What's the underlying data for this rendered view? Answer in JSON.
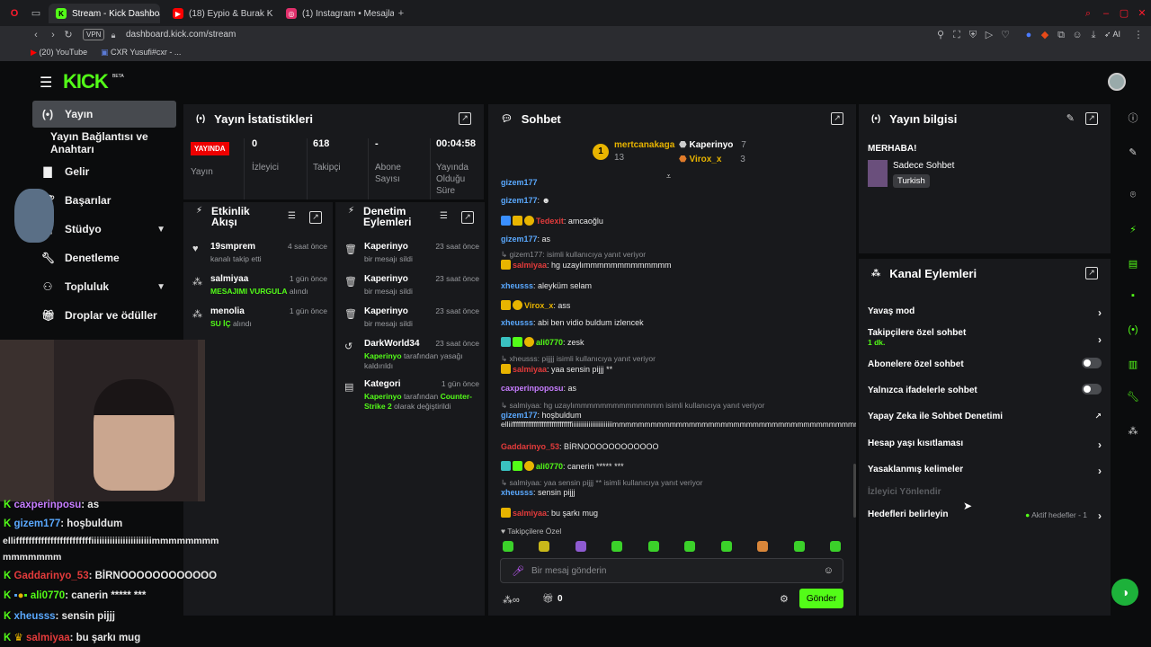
{
  "browser": {
    "tabs": [
      {
        "label": "Stream - Kick Dashboard",
        "active": true,
        "color": "#53fc18"
      },
      {
        "label": "(18) Eypio & Burak King",
        "active": false,
        "color": "#ff0000"
      },
      {
        "label": "(1) Instagram • Mesajlar",
        "active": false,
        "color": "#e1306c"
      }
    ],
    "vpn": "VPN",
    "url": "dashboard.kick.com/stream",
    "ai_label": "AI",
    "bookmarks": [
      "(20) YouTube",
      "CXR Yusufi#cxr - ..."
    ]
  },
  "kick": {
    "logo": "KICK",
    "beta": "BETA"
  },
  "sidebar": {
    "items": [
      {
        "label": "Yayın",
        "icon": "broadcast-icon",
        "active": true
      },
      {
        "label": "Yayın Bağlantısı ve Anahtarı",
        "icon": "",
        "active": false
      },
      {
        "label": "Gelir",
        "icon": "chart-icon",
        "active": false
      },
      {
        "label": "Başarılar",
        "icon": "trophy-icon",
        "active": false
      },
      {
        "label": "Stüdyo",
        "icon": "studio-icon",
        "active": false
      },
      {
        "label": "Denetleme",
        "icon": "wrench-icon",
        "active": false
      },
      {
        "label": "Topluluk",
        "icon": "community-icon",
        "active": false
      },
      {
        "label": "Droplar ve ödüller",
        "icon": "gift-icon",
        "active": false
      }
    ]
  },
  "stats": {
    "title": "Yayın İstatistikleri",
    "live": "YAYINDA",
    "live_label": "Yayın",
    "items": [
      {
        "value": "0",
        "label": "İzleyici"
      },
      {
        "value": "618",
        "label": "Takipçi"
      },
      {
        "value": "-",
        "label": "Abone Sayısı"
      },
      {
        "value": "00:04:58",
        "label": "Yayında Olduğu Süre"
      }
    ]
  },
  "activity": {
    "title": "Etkinlik Akışı",
    "items": [
      {
        "user": "19smprem",
        "time": "4 saat önce",
        "desc": "kanalı takip etti",
        "hl": ""
      },
      {
        "user": "salmiyaa",
        "time": "1 gün önce",
        "desc": "alındı",
        "hl": "MESAJIMI VURGULA"
      },
      {
        "user": "menolia",
        "time": "1 gün önce",
        "desc": "alındı",
        "hl": "SU İÇ"
      }
    ]
  },
  "moderation": {
    "title": "Denetim Eylemleri",
    "items": [
      {
        "user": "Kaperinyo",
        "time": "23 saat önce",
        "desc": "bir mesajı sildi"
      },
      {
        "user": "Kaperinyo",
        "time": "23 saat önce",
        "desc": "bir mesajı sildi"
      },
      {
        "user": "Kaperinyo",
        "time": "23 saat önce",
        "desc": "bir mesajı sildi"
      },
      {
        "user": "DarkWorld34",
        "time": "23 saat önce",
        "desc1": "Kaperinyo",
        "desc2": " tarafından yasağı kaldırıldı"
      },
      {
        "user": "Kategori",
        "time": "1 gün önce",
        "desc1": "Kaperinyo",
        "desc2": " tarafından ",
        "desc3": "Counter-Strike 2",
        "desc4": " olarak değiştirildi"
      }
    ]
  },
  "chat": {
    "title": "Sohbet",
    "top": [
      {
        "name": "mertcanakaga",
        "count": "13"
      },
      {
        "name": "Kaperinyo",
        "count": "7"
      },
      {
        "name": "Virox_x",
        "count": "3"
      }
    ],
    "messages": [
      {
        "user": "gizem177",
        "text": "",
        "color": "#5aa9ff"
      },
      {
        "user": "Tedexit",
        "text": ": amcaoğlu",
        "color": "#e33b3b"
      },
      {
        "user": "gizem177",
        "text": ": as",
        "color": "#5aa9ff"
      },
      {
        "reply": "gizem177:  isimli kullanıcıya yanıt veriyor",
        "user": "salmiyaa",
        "text": ": hg uzaylımmmmmmmmmmmmm",
        "color": "#e33b3b"
      },
      {
        "user": "xheusss",
        "text": ": aleyküm selam",
        "color": "#5aa9ff"
      },
      {
        "user": "Virox_x",
        "text": ": ass",
        "color": "#e8b400"
      },
      {
        "user": "xheusss",
        "text": ": abi ben vidio buldum izlencek",
        "color": "#5aa9ff"
      },
      {
        "user": "ali0770",
        "text": ": zesk",
        "color": "#53fc18"
      },
      {
        "reply": "xheusss: pijjjj isimli kullanıcıya yanıt veriyor",
        "user": "salmiyaa",
        "text": ": yaa sensin pijjj **",
        "color": "#e33b3b"
      },
      {
        "user": "caxperinpoposu",
        "text": ": as",
        "color": "#c77dff"
      },
      {
        "reply": "salmiyaa: hg uzaylımmmmmmmmmmmmmm isimli kullanıcıya yanıt veriyor",
        "user": "gizem177",
        "text": ": hoşbuldum",
        "color": "#5aa9ff"
      },
      {
        "user": "",
        "text": "elliiffffffffffffffffffffffffffffffiiiiiiiiiiiiiiiiiiiiiiiimmmmmmmmmmmmmmmmmmmmmmmmmmmmmmmmmmmmmmmmmm",
        "color": "#e8e8e8"
      },
      {
        "user": "Gaddarinyo_53",
        "text": ": BİRNOOOOOOOOOOOO",
        "color": "#e33b3b"
      },
      {
        "user": "ali0770",
        "text": ": canerin ***** ***",
        "color": "#53fc18"
      },
      {
        "reply": "salmiyaa: yaa sensin pijjj ** isimli kullanıcıya yanıt veriyor",
        "user": "xheusss",
        "text": ": sensin pijjj",
        "color": "#5aa9ff"
      },
      {
        "user": "salmiyaa",
        "text": ": bu şarkı mug",
        "color": "#e33b3b"
      }
    ],
    "followers_only": "Takipçilere Özel",
    "placeholder": "Bir mesaj gönderin",
    "points": "0",
    "send": "Gönder"
  },
  "info": {
    "title": "Yayın bilgisi",
    "greeting": "MERHABA!",
    "category": "Sadece Sohbet",
    "language": "Turkish"
  },
  "channel_actions": {
    "title": "Kanal Eylemleri",
    "items": [
      {
        "label": "Yavaş mod",
        "type": "arrow"
      },
      {
        "label": "Takipçilere özel sohbet",
        "sub": "1 dk.",
        "type": "arrow"
      },
      {
        "label": "Abonelere özel sohbet",
        "type": "toggle"
      },
      {
        "label": "Yalnızca ifadelerle sohbet",
        "type": "toggle"
      },
      {
        "label": "Yapay Zeka ile Sohbet Denetimi",
        "type": "external"
      },
      {
        "label": "Hesap yaşı kısıtlaması",
        "type": "arrow"
      },
      {
        "label": "Yasaklanmış kelimeler",
        "type": "arrow"
      },
      {
        "label": "İzleyici Yönlendir",
        "type": "disabled"
      },
      {
        "label": "Hedefleri belirleyin",
        "type": "arrow",
        "status": "Aktif hedefler - 1"
      }
    ]
  },
  "overlay_chat": [
    {
      "user": "caxperinposu",
      "text": ": as",
      "color": "#c77dff"
    },
    {
      "user": "gizem177",
      "text": ": hoşbuldum",
      "color": "#5aa9ff"
    },
    {
      "user": "",
      "text": "elliffffffffffffffffffffffffiiiiiiiiiiiiiiiiiiiiiiimmmmmmmm",
      "color": "#ffffff"
    },
    {
      "user": "",
      "text": "mmmmmmm",
      "color": "#ffffff"
    },
    {
      "user": "Gaddarinyo_53",
      "text": ": BİRNOOOOOOOOOOOO",
      "color": "#e33b3b"
    },
    {
      "user": "ali0770",
      "text": ": canerin ***** ***",
      "color": "#53fc18"
    },
    {
      "user": "xheusss",
      "text": ": sensin pijjj",
      "color": "#5aa9ff"
    },
    {
      "user": "salmiyaa",
      "text": ": bu şarkı mug",
      "color": "#e33b3b"
    }
  ],
  "colors": {
    "accent": "#53fc18",
    "live": "#e00",
    "panel": "#18191c",
    "bg": "#0b0c0d"
  }
}
